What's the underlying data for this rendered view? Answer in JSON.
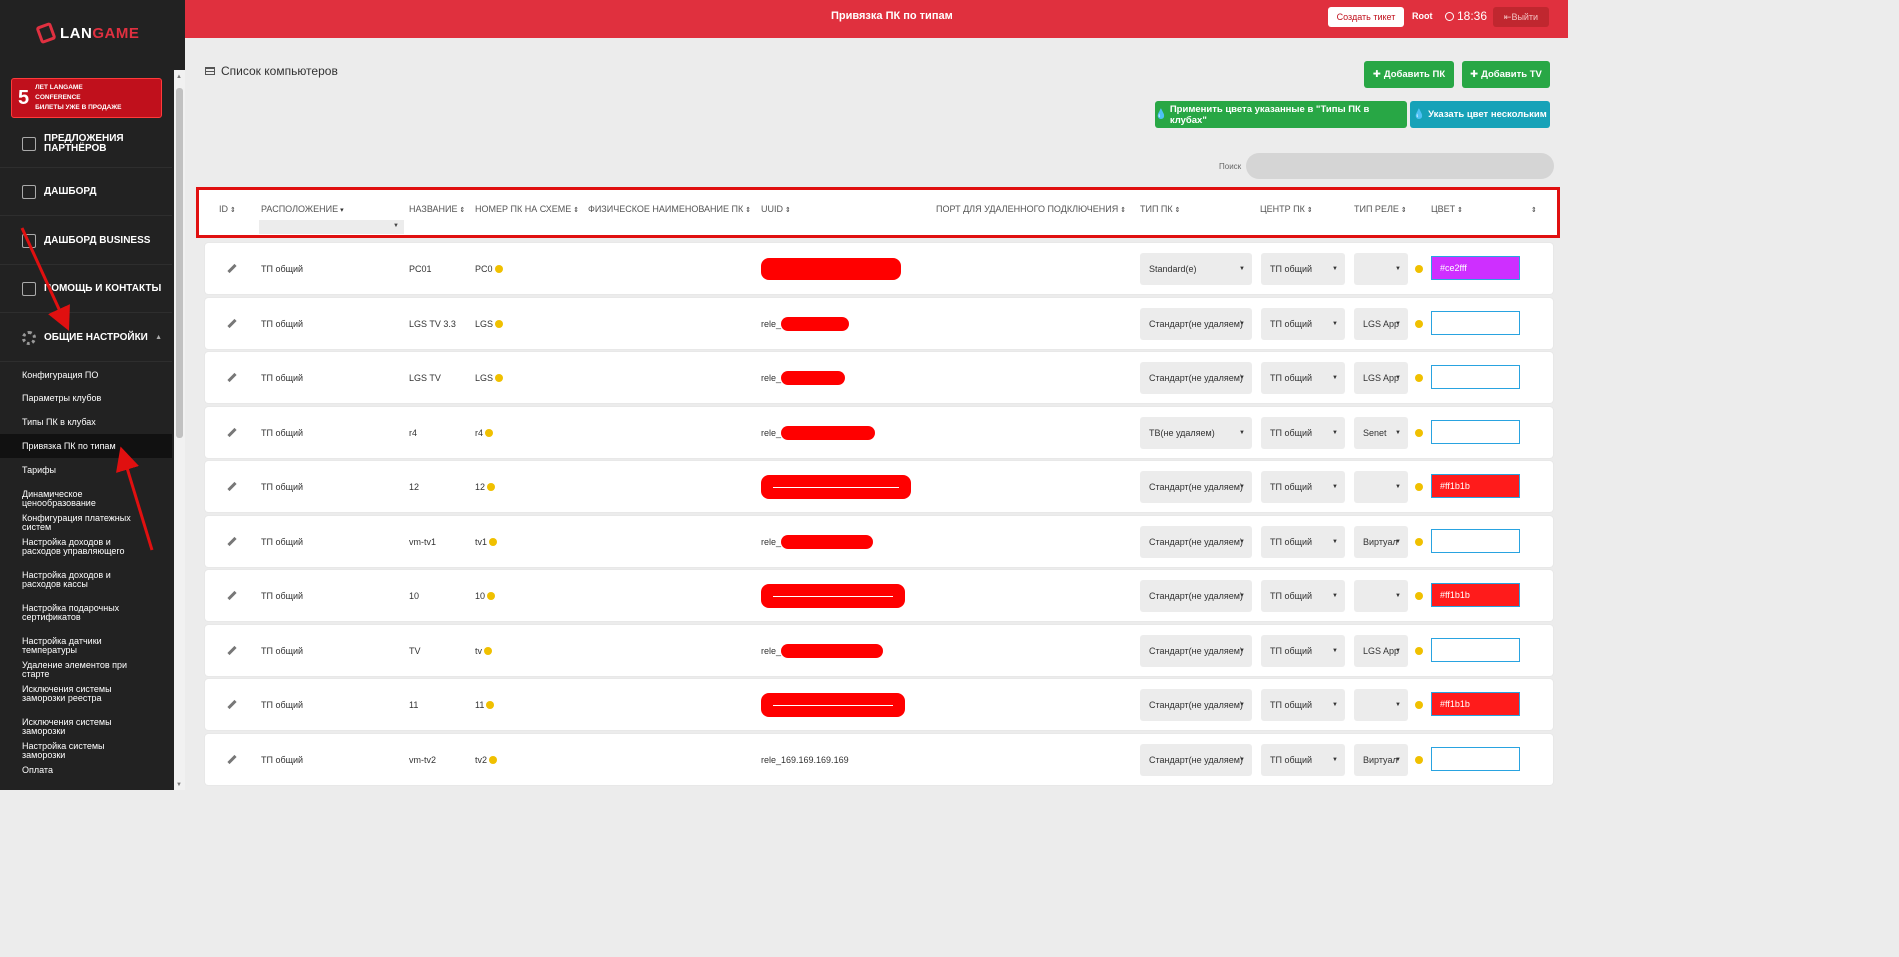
{
  "header": {
    "page_title": "Привязка ПК по типам",
    "ticket_button": "Создать тикет",
    "user": "Root",
    "time": "18:36",
    "logout": "Выйти"
  },
  "sidebar": {
    "logo_text_1": "LAN",
    "logo_text_2": "GAME",
    "banner": {
      "number": "5",
      "line1": "ЛЕТ LANGAME",
      "line2": "CONFERENCE",
      "line3": "БИЛЕТЫ УЖЕ В ПРОДАЖЕ"
    },
    "items": [
      {
        "label": "ПРЕДЛОЖЕНИЯ ПАРТНЁРОВ"
      },
      {
        "label": "ДАШБОРД"
      },
      {
        "label": "ДАШБОРД BUSINESS"
      },
      {
        "label": "ПОМОЩЬ И КОНТАКТЫ"
      },
      {
        "label": "ОБЩИЕ НАСТРОЙКИ"
      }
    ],
    "submenu": [
      "Конфигурация ПО",
      "Параметры клубов",
      "Типы ПК в клубах",
      "Привязка ПК по типам",
      "Тарифы",
      "Динамическое ценообразование",
      "Конфигурация платежных систем",
      "Настройка доходов и расходов управляющего",
      "Настройка доходов и расходов кассы",
      "Настройка подарочных сертификатов",
      "Настройка датчики температуры",
      "Удаление элементов при старте",
      "Исключения системы заморозки реестра",
      "Исключения системы заморозки",
      "Настройка системы заморозки",
      "Оплата"
    ]
  },
  "main": {
    "list_title": "Список компьютеров",
    "buttons": {
      "add_pc": "Добавить ПК",
      "add_tv": "Добавить TV",
      "apply_colors": "Применить цвета указанные в \"Типы ПК в клубах\"",
      "set_color": "Указать цвет нескольким"
    },
    "search_label": "Поиск",
    "columns": [
      "ID",
      "РАСПОЛОЖЕНИЕ",
      "НАЗВАНИЕ",
      "НОМЕР ПК НА СХЕМЕ",
      "ФИЗИЧЕСКОЕ НАИМЕНОВАНИЕ ПК",
      "UUID",
      "ПОРТ ДЛЯ УДАЛЕННОГО ПОДКЛЮЧЕНИЯ",
      "ТИП ПК",
      "ЦЕНТР ПК",
      "ТИП РЕЛЕ",
      "ЦВЕТ"
    ],
    "rows": [
      {
        "location": "ТП общий",
        "name": "PC01",
        "number": "PC0",
        "uuid": "",
        "pc_type": "Standard(e)",
        "center": "ТП общий",
        "rele": "",
        "color": "#ce2fff"
      },
      {
        "location": "ТП общий",
        "name": "LGS TV 3.3",
        "number": "LGS",
        "uuid": "rele_",
        "pc_type": "Стандарт(не удаляем)",
        "center": "ТП общий",
        "rele": "LGS App",
        "color": ""
      },
      {
        "location": "ТП общий",
        "name": "LGS TV",
        "number": "LGS",
        "uuid": "rele_",
        "pc_type": "Стандарт(не удаляем)",
        "center": "ТП общий",
        "rele": "LGS App",
        "color": ""
      },
      {
        "location": "ТП общий",
        "name": "r4",
        "number": "r4",
        "uuid": "rele_",
        "pc_type": "ТВ(не удаляем)",
        "center": "ТП общий",
        "rele": "Senet",
        "color": ""
      },
      {
        "location": "ТП общий",
        "name": "12",
        "number": "12",
        "uuid": "",
        "pc_type": "Стандарт(не удаляем)",
        "center": "ТП общий",
        "rele": "",
        "color": "#ff1b1b"
      },
      {
        "location": "ТП общий",
        "name": "vm-tv1",
        "number": "tv1",
        "uuid": "rele_",
        "pc_type": "Стандарт(не удаляем)",
        "center": "ТП общий",
        "rele": "Виртуал",
        "color": ""
      },
      {
        "location": "ТП общий",
        "name": "10",
        "number": "10",
        "uuid": "",
        "pc_type": "Стандарт(не удаляем)",
        "center": "ТП общий",
        "rele": "",
        "color": "#ff1b1b"
      },
      {
        "location": "ТП общий",
        "name": "TV",
        "number": "tv",
        "uuid": "rele_",
        "pc_type": "Стандарт(не удаляем)",
        "center": "ТП общий",
        "rele": "LGS App",
        "color": ""
      },
      {
        "location": "ТП общий",
        "name": "11",
        "number": "11",
        "uuid": "",
        "pc_type": "Стандарт(не удаляем)",
        "center": "ТП общий",
        "rele": "",
        "color": "#ff1b1b"
      },
      {
        "location": "ТП общий",
        "name": "vm-tv2",
        "number": "tv2",
        "uuid": "rele_169.169.169.169",
        "pc_type": "Стандарт(не удаляем)",
        "center": "ТП общий",
        "rele": "Виртуал",
        "color": ""
      }
    ]
  },
  "colors": {
    "header_red": "#e0303e",
    "sidebar_bg": "#222222",
    "highlight_border": "#e01010",
    "success": "#28a745",
    "info": "#17a2b8"
  }
}
